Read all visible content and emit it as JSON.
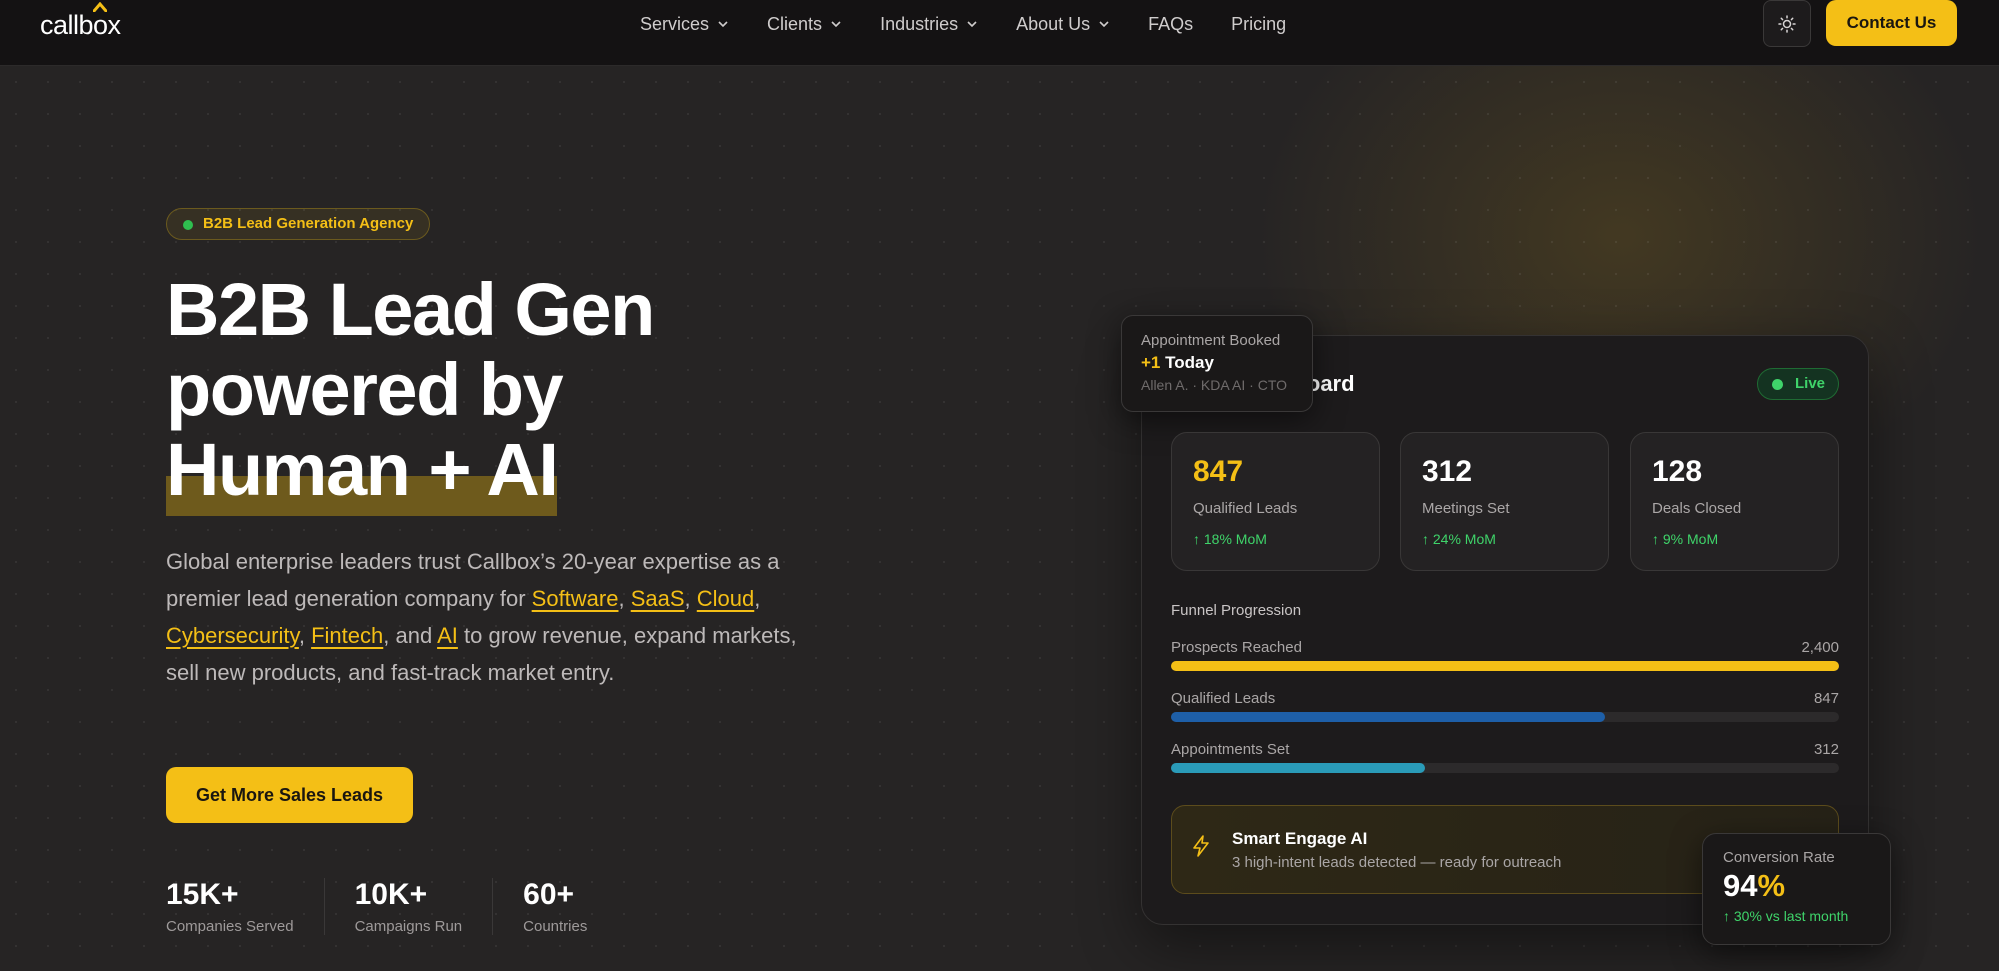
{
  "nav": {
    "logo": "callbox",
    "items": [
      {
        "label": "Services",
        "has_dropdown": true
      },
      {
        "label": "Clients",
        "has_dropdown": true
      },
      {
        "label": "Industries",
        "has_dropdown": true
      },
      {
        "label": "About Us",
        "has_dropdown": true
      },
      {
        "label": "FAQs",
        "has_dropdown": false
      },
      {
        "label": "Pricing",
        "has_dropdown": false
      }
    ],
    "theme_icon": "sun-icon",
    "contact_label": "Contact Us"
  },
  "hero": {
    "badge": "B2B Lead Generation Agency",
    "headline": [
      "B2B Lead Gen",
      "powered by",
      "Human + AI"
    ],
    "desc_start": "Global enterprise leaders trust Callbox’s 20-year expertise as a premier lead generation company for ",
    "links": [
      "Software",
      "SaaS",
      "Cloud",
      "Cybersecurity",
      "Fintech",
      "AI"
    ],
    "desc_end": " to grow revenue, expand markets, sell new products, and fast-track market entry.",
    "cta": "Get More Sales Leads",
    "stats": [
      {
        "value": "15K+",
        "label": "Companies Served"
      },
      {
        "value": "10K+",
        "label": "Campaigns Run"
      },
      {
        "value": "60+",
        "label": "Countries"
      }
    ]
  },
  "dashboard": {
    "title_visible": "nboard",
    "live": "Live",
    "appointment": {
      "title": "Appointment Booked",
      "plus": "+1",
      "today": " Today",
      "sub": "Allen A. · KDA AI · CTO"
    },
    "kpis": [
      {
        "value": "847",
        "label": "Qualified Leads",
        "delta": "↑ 18% MoM"
      },
      {
        "value": "312",
        "label": "Meetings Set",
        "delta": "↑ 24% MoM"
      },
      {
        "value": "128",
        "label": "Deals Closed",
        "delta": "↑ 9% MoM"
      }
    ],
    "funnel_title": "Funnel Progression",
    "funnel": [
      {
        "label": "Prospects Reached",
        "value": "2,400",
        "fraction": 1.0,
        "color": "#f4bf16"
      },
      {
        "label": "Qualified Leads",
        "value": "847",
        "fraction": 0.65,
        "color": "#1e5fa8"
      },
      {
        "label": "Appointments Set",
        "value": "312",
        "fraction": 0.38,
        "color": "#2a9bb8"
      }
    ],
    "ai": {
      "title": "Smart Engage AI",
      "sub": "3 high-intent leads detected — ready for outreach"
    },
    "conversion": {
      "title": "Conversion Rate",
      "value": "94",
      "pct": "%",
      "delta": "↑ 30% vs last month"
    }
  },
  "colors": {
    "accent": "#f4bf16",
    "success": "#3fd46a",
    "background": "#262424"
  }
}
